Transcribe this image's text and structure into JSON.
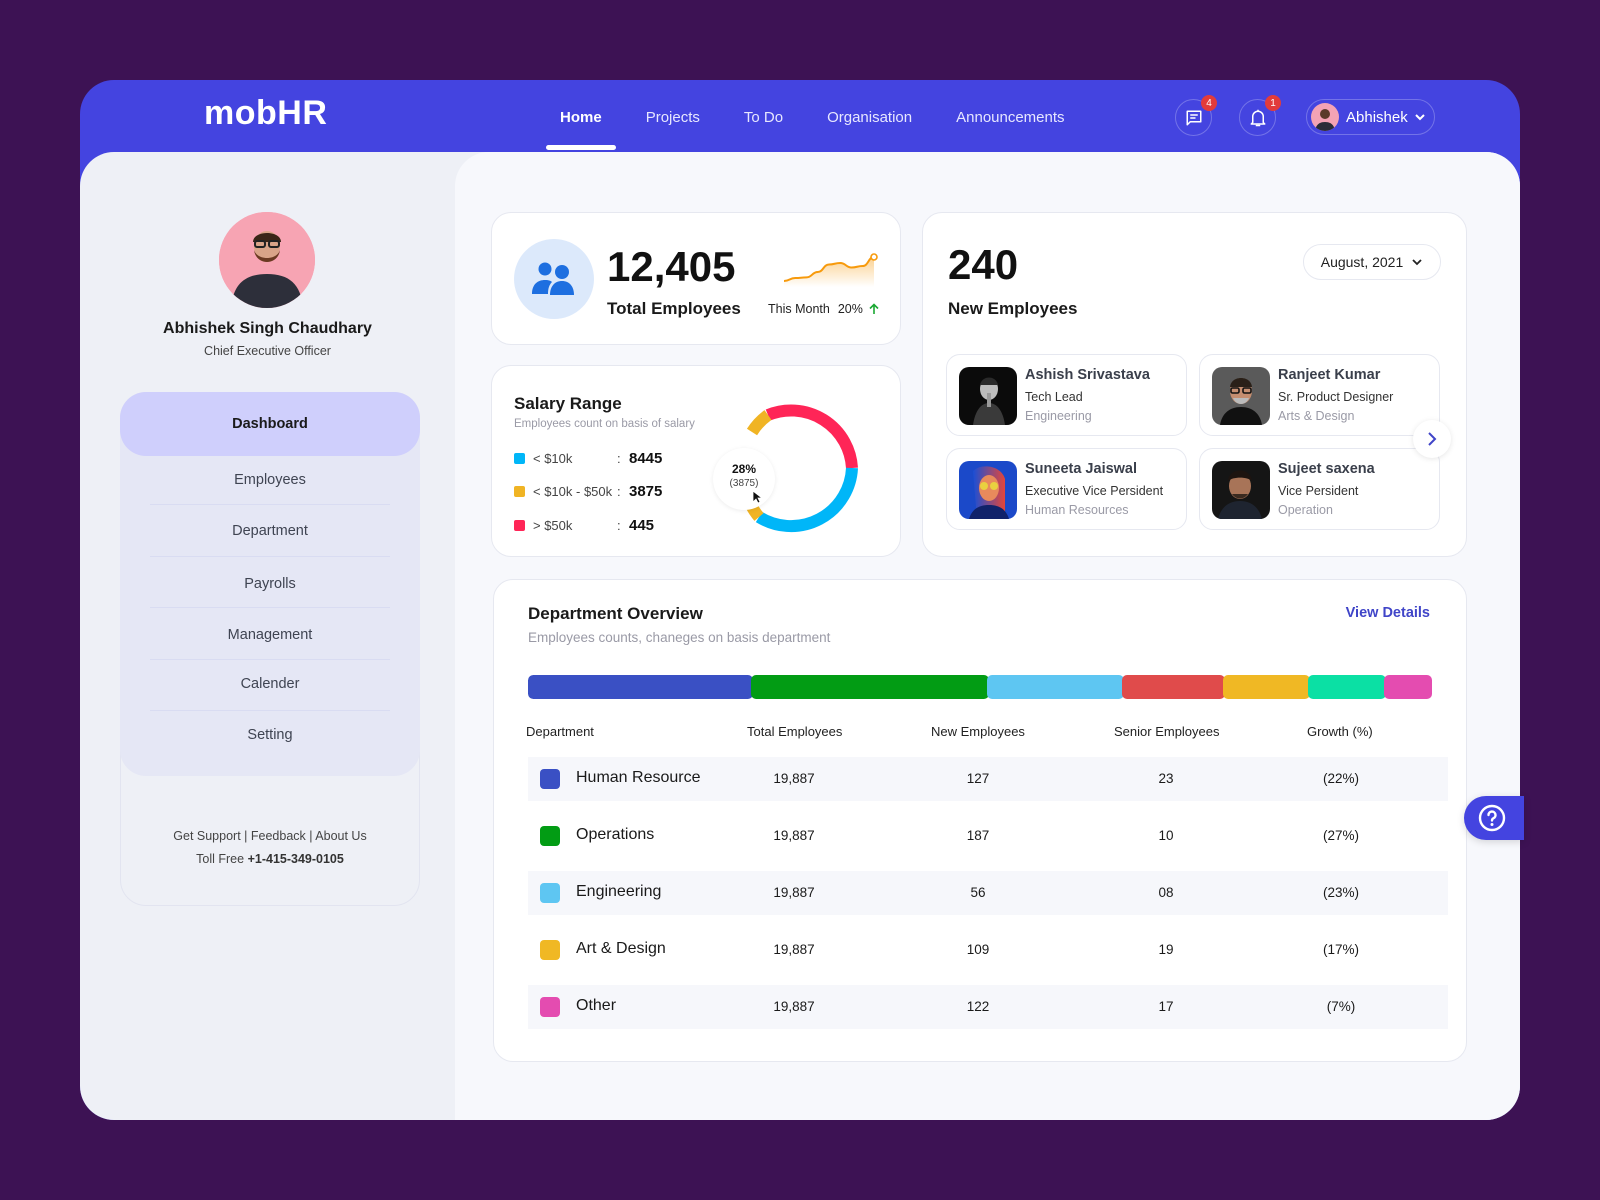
{
  "app": {
    "logo": "mobHR"
  },
  "nav": {
    "items": [
      {
        "label": "Home",
        "active": true
      },
      {
        "label": "Projects"
      },
      {
        "label": "To Do"
      },
      {
        "label": "Organisation"
      },
      {
        "label": "Announcements"
      }
    ],
    "messages_badge": "4",
    "notifications_badge": "1",
    "user_name": "Abhishek"
  },
  "profile": {
    "name": "Abhishek Singh Chaudhary",
    "role": "Chief Executive Officer"
  },
  "sidebar": {
    "items": [
      {
        "label": "Dashboard",
        "active": true
      },
      {
        "label": "Employees"
      },
      {
        "label": "Department"
      },
      {
        "label": "Payrolls"
      },
      {
        "label": "Management"
      },
      {
        "label": "Calender"
      },
      {
        "label": "Setting"
      }
    ],
    "support_links": [
      "Get Support",
      "Feedback",
      "About Us"
    ],
    "toll_free_label": "Toll Free",
    "toll_free_number": "+1-415-349-0105"
  },
  "total_employees": {
    "value": "12,405",
    "label": "Total Employees",
    "period_label": "This Month",
    "change": "20%",
    "trend": "up",
    "sparkline": [
      2,
      3,
      3.2,
      5,
      7.5,
      8,
      6.5,
      7,
      10
    ]
  },
  "salary_range": {
    "title": "Salary Range",
    "subtitle": "Employees count on basis of salary",
    "ranges": [
      {
        "label": "< $10k",
        "value": "8445",
        "count": 8445,
        "color": "#00b6f8"
      },
      {
        "label": "< $10k - $50k",
        "value": "3875",
        "count": 3875,
        "color": "#f0b424"
      },
      {
        "label": "> $50k",
        "value": "445",
        "count": 445,
        "color": "#ff2557"
      }
    ],
    "tooltip_percent": "28%",
    "tooltip_count": "(3875)"
  },
  "new_employees": {
    "value": "240",
    "label": "New Employees",
    "month_selected": "August, 2021",
    "people": [
      {
        "name": "Ashish Srivastava",
        "role": "Tech Lead",
        "department": "Engineering"
      },
      {
        "name": "Ranjeet Kumar",
        "role": "Sr. Product Designer",
        "department": "Arts & Design"
      },
      {
        "name": "Suneeta Jaiswal",
        "role": "Executive Vice Persident",
        "department": "Human Resources"
      },
      {
        "name": "Sujeet saxena",
        "role": "Vice Persident",
        "department": "Operation"
      }
    ]
  },
  "department_overview": {
    "title": "Department Overview",
    "subtitle": "Employees counts, chaneges on basis department",
    "view_details": "View Details",
    "bar_segments": [
      {
        "name": "Human Resource",
        "share": 24.6,
        "color": "#3a50c4"
      },
      {
        "name": "Operations",
        "share": 25.9,
        "color": "#029c14"
      },
      {
        "name": "Engineering",
        "share": 15.0,
        "color": "#5ec6f2"
      },
      {
        "name": "Unlabeled red",
        "share": 11.3,
        "color": "#e04b4b"
      },
      {
        "name": "Art & Design",
        "share": 9.4,
        "color": "#f0b824"
      },
      {
        "name": "Unlabeled teal",
        "share": 8.6,
        "color": "#0be0a4"
      },
      {
        "name": "Other",
        "share": 5.2,
        "color": "#e44cb0"
      }
    ],
    "columns": [
      "Department",
      "Total Employees",
      "New Employees",
      "Senior Employees",
      "Growth (%)"
    ],
    "rows": [
      {
        "department": "Human Resource",
        "total": "19,887",
        "new": "127",
        "senior": "23",
        "growth": "(22%)",
        "color": "#3a50c4"
      },
      {
        "department": "Operations",
        "total": "19,887",
        "new": "187",
        "senior": "10",
        "growth": "(27%)",
        "color": "#029c14"
      },
      {
        "department": "Engineering",
        "total": "19,887",
        "new": "56",
        "senior": "08",
        "growth": "(23%)",
        "color": "#5ec6f2"
      },
      {
        "department": "Art & Design",
        "total": "19,887",
        "new": "109",
        "senior": "19",
        "growth": "(17%)",
        "color": "#f0b824"
      },
      {
        "department": "Other",
        "total": "19,887",
        "new": "122",
        "senior": "17",
        "growth": "(7%)",
        "color": "#e44cb0"
      }
    ]
  },
  "colors": {
    "brand": "#4444e0",
    "background": "#3d1254",
    "accent_link": "#4045c8",
    "sparkline": "#f79a0c",
    "trend_up": "#1aa832"
  }
}
